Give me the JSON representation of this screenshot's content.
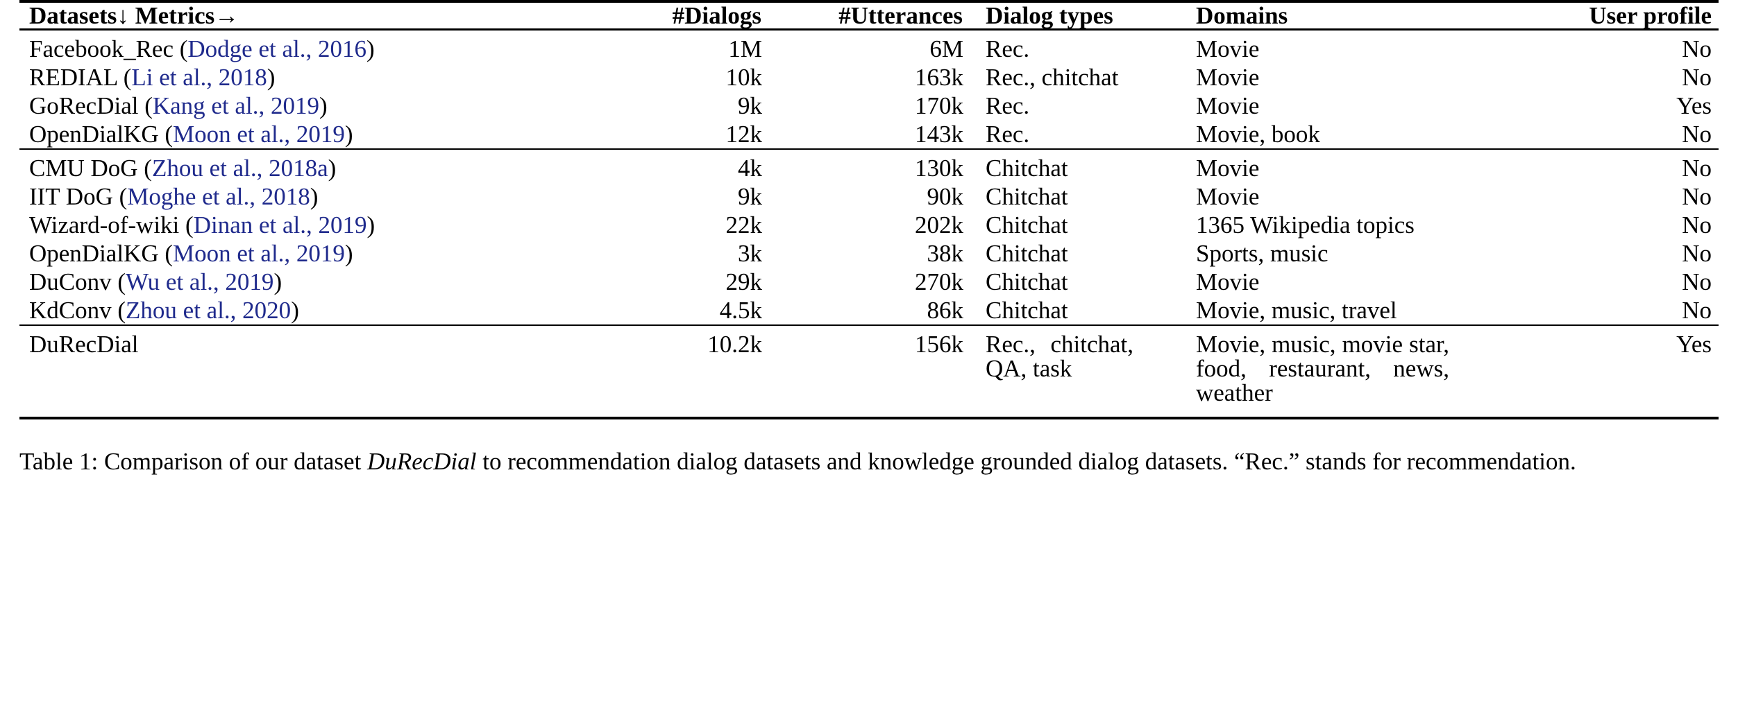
{
  "table": {
    "columns": [
      {
        "key": "dataset",
        "label": "Datasets↓ Metrics→",
        "align": "left"
      },
      {
        "key": "dialogs",
        "label": "#Dialogs",
        "align": "right"
      },
      {
        "key": "utterances",
        "label": "#Utterances",
        "align": "right"
      },
      {
        "key": "dialog_types",
        "label": "Dialog types",
        "align": "left"
      },
      {
        "key": "domains",
        "label": "Domains",
        "align": "left"
      },
      {
        "key": "user_profile",
        "label": "User profile",
        "align": "right"
      }
    ],
    "citation_color": "#1f2a8c",
    "blocks": [
      {
        "name": "recommendation-dialog-datasets",
        "rows": [
          {
            "dataset_name": "Facebook_Rec",
            "citation": "Dodge et al., 2016",
            "dialogs": "1M",
            "utterances": "6M",
            "dialog_types": "Rec.",
            "domains": "Movie",
            "user_profile": "No"
          },
          {
            "dataset_name": "REDIAL",
            "citation": "Li et al., 2018",
            "dialogs": "10k",
            "utterances": "163k",
            "dialog_types": "Rec., chitchat",
            "domains": "Movie",
            "user_profile": "No"
          },
          {
            "dataset_name": "GoRecDial",
            "citation": "Kang et al., 2019",
            "dialogs": "9k",
            "utterances": "170k",
            "dialog_types": "Rec.",
            "domains": "Movie",
            "user_profile": "Yes"
          },
          {
            "dataset_name": "OpenDialKG",
            "citation": "Moon et al., 2019",
            "dialogs": "12k",
            "utterances": "143k",
            "dialog_types": "Rec.",
            "domains": "Movie, book",
            "user_profile": "No"
          }
        ]
      },
      {
        "name": "knowledge-grounded-dialog-datasets",
        "rows": [
          {
            "dataset_name": "CMU DoG",
            "citation": "Zhou et al., 2018a",
            "dialogs": "4k",
            "utterances": "130k",
            "dialog_types": "Chitchat",
            "domains": "Movie",
            "user_profile": "No"
          },
          {
            "dataset_name": "IIT DoG",
            "citation": "Moghe et al., 2018",
            "dialogs": "9k",
            "utterances": "90k",
            "dialog_types": "Chitchat",
            "domains": "Movie",
            "user_profile": "No"
          },
          {
            "dataset_name": "Wizard-of-wiki",
            "citation": "Dinan et al., 2019",
            "dialogs": "22k",
            "utterances": "202k",
            "dialog_types": "Chitchat",
            "domains": "1365 Wikipedia topics",
            "user_profile": "No"
          },
          {
            "dataset_name": "OpenDialKG",
            "citation": "Moon et al., 2019",
            "dialogs": "3k",
            "utterances": "38k",
            "dialog_types": "Chitchat",
            "domains": "Sports, music",
            "user_profile": "No"
          },
          {
            "dataset_name": "DuConv",
            "citation": "Wu et al., 2019",
            "dialogs": "29k",
            "utterances": "270k",
            "dialog_types": "Chitchat",
            "domains": "Movie",
            "user_profile": "No"
          },
          {
            "dataset_name": "KdConv",
            "citation": "Zhou et al., 2020",
            "dialogs": "4.5k",
            "utterances": "86k",
            "dialog_types": "Chitchat",
            "domains": "Movie, music, travel",
            "user_profile": "No"
          }
        ]
      },
      {
        "name": "our-dataset",
        "rows": [
          {
            "dataset_name": "DuRecDial",
            "citation": "",
            "dialogs": "10.2k",
            "utterances": "156k",
            "dialog_types": "Rec., chitchat, QA, task",
            "domains": "Movie, music, movie star, food, restaurant, news, weather",
            "user_profile": "Yes"
          }
        ]
      }
    ]
  },
  "caption": {
    "prefix": "Table 1: Comparison of our dataset ",
    "emphasis": "DuRecDial",
    "suffix": " to recommendation dialog datasets and knowledge grounded dialog datasets. “Rec.” stands for recommendation."
  }
}
